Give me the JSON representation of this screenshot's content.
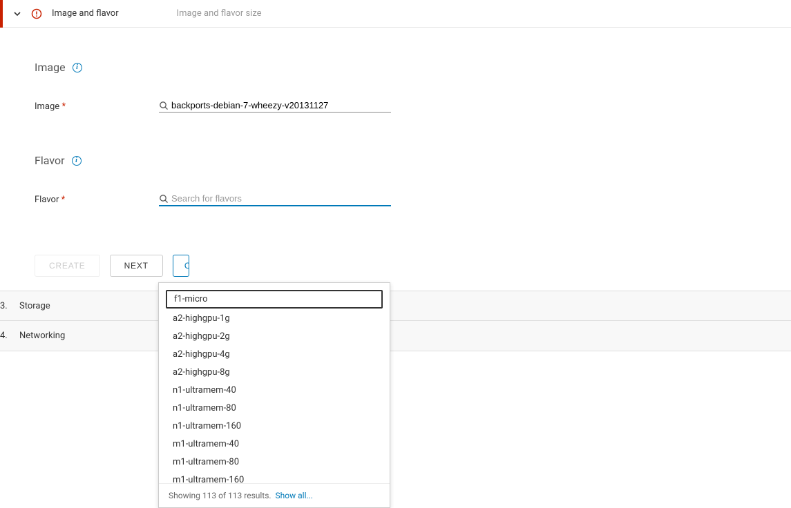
{
  "header": {
    "title": "Image and flavor",
    "subtitle": "Image and flavor size"
  },
  "sections": {
    "image_heading": "Image",
    "flavor_heading": "Flavor"
  },
  "image_field": {
    "label": "Image",
    "value": "backports-debian-7-wheezy-v20131127"
  },
  "flavor_field": {
    "label": "Flavor",
    "placeholder": "Search for flavors"
  },
  "buttons": {
    "create": "Create",
    "next": "Next",
    "cancel": "C"
  },
  "steps": {
    "storage_num": "3.",
    "storage_label": "Storage",
    "networking_num": "4.",
    "networking_label": "Networking"
  },
  "dropdown": {
    "items": [
      "f1-micro",
      "a2-highgpu-1g",
      "a2-highgpu-2g",
      "a2-highgpu-4g",
      "a2-highgpu-8g",
      "n1-ultramem-40",
      "n1-ultramem-80",
      "n1-ultramem-160",
      "m1-ultramem-40",
      "m1-ultramem-80",
      "m1-ultramem-160"
    ],
    "footer_text": "Showing 113 of 113 results.",
    "footer_link": "Show all..."
  }
}
